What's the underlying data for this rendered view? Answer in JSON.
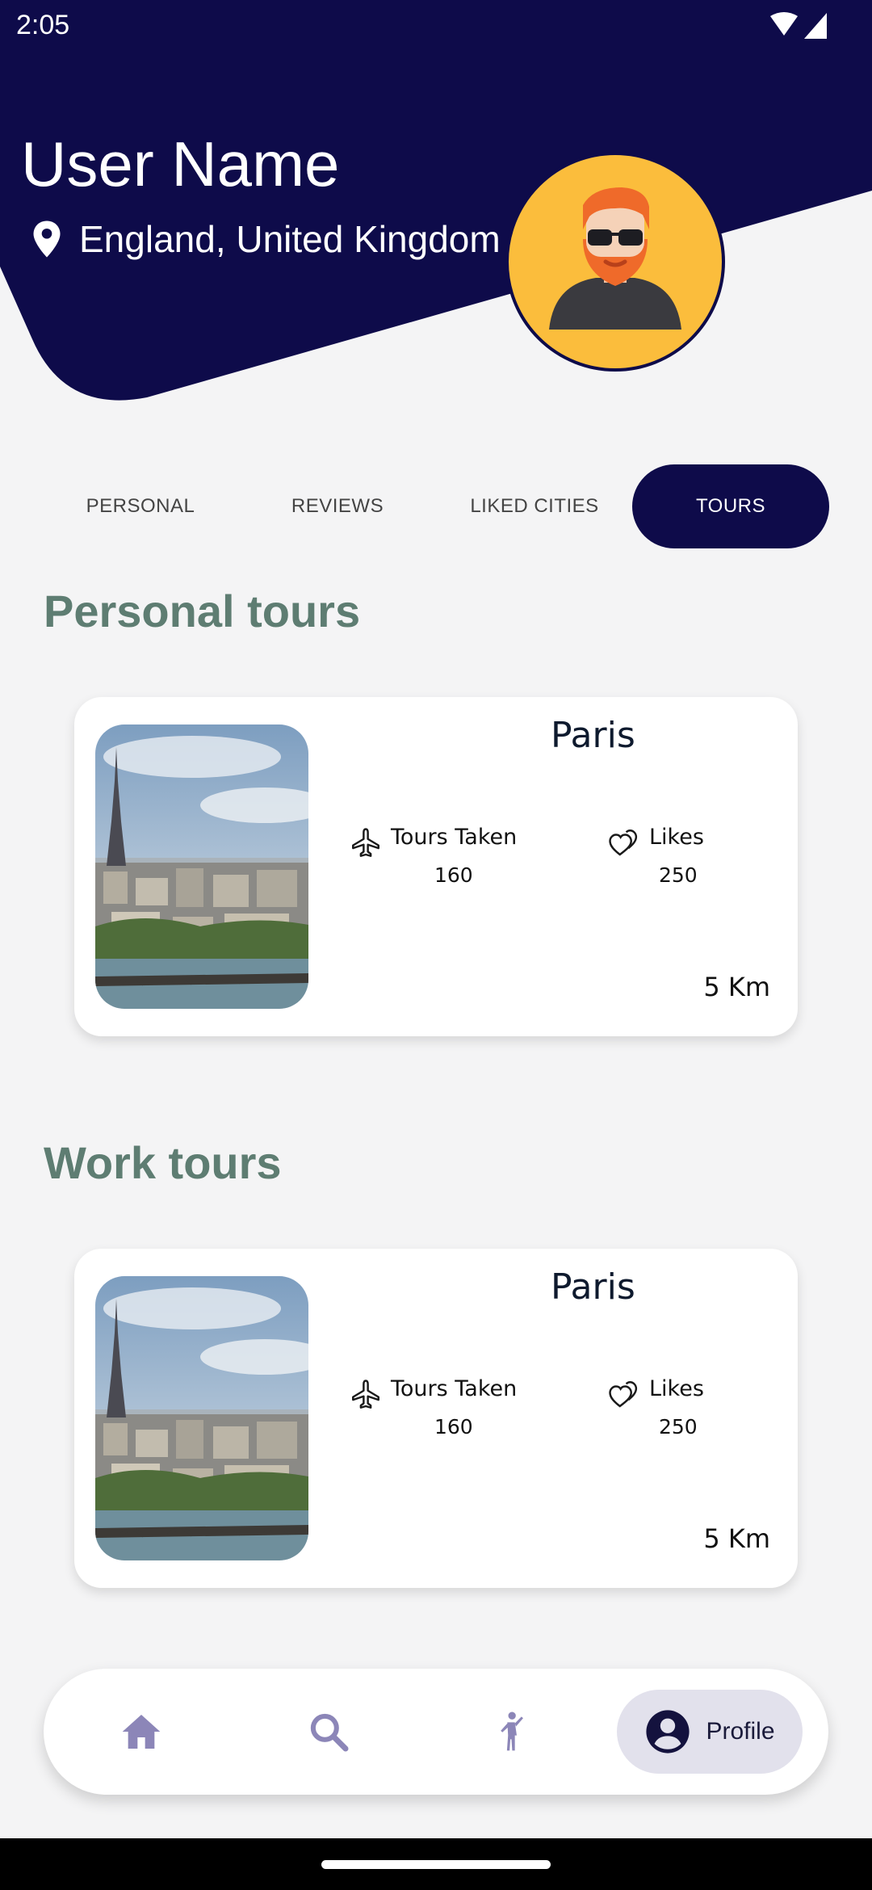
{
  "status_bar": {
    "time": "2:05"
  },
  "header": {
    "user_name": "User Name",
    "location": "England, United Kingdom"
  },
  "tabs": [
    {
      "label": "PERSONAL",
      "active": false
    },
    {
      "label": "REVIEWS",
      "active": false
    },
    {
      "label": "LIKED CITIES",
      "active": false
    },
    {
      "label": "TOURS",
      "active": true
    }
  ],
  "sections": [
    {
      "title": "Personal tours",
      "card": {
        "city": "Paris",
        "tours_label": "Tours Taken",
        "tours_value": "160",
        "likes_label": "Likes",
        "likes_value": "250",
        "distance": "5 Km"
      }
    },
    {
      "title": "Work tours",
      "card": {
        "city": "Paris",
        "tours_label": "Tours Taken",
        "tours_value": "160",
        "likes_label": "Likes",
        "likes_value": "250",
        "distance": "5 Km"
      }
    }
  ],
  "bottom_nav": {
    "items": [
      {
        "icon": "home-icon"
      },
      {
        "icon": "search-icon"
      },
      {
        "icon": "walking-person-icon"
      },
      {
        "icon": "account-circle-icon",
        "label": "Profile",
        "active": true
      }
    ]
  },
  "colors": {
    "header": "#0e0b4a",
    "section_title": "#5e7d72",
    "avatar_bg": "#fbbd3c",
    "nav_inactive": "#8c86b8"
  }
}
